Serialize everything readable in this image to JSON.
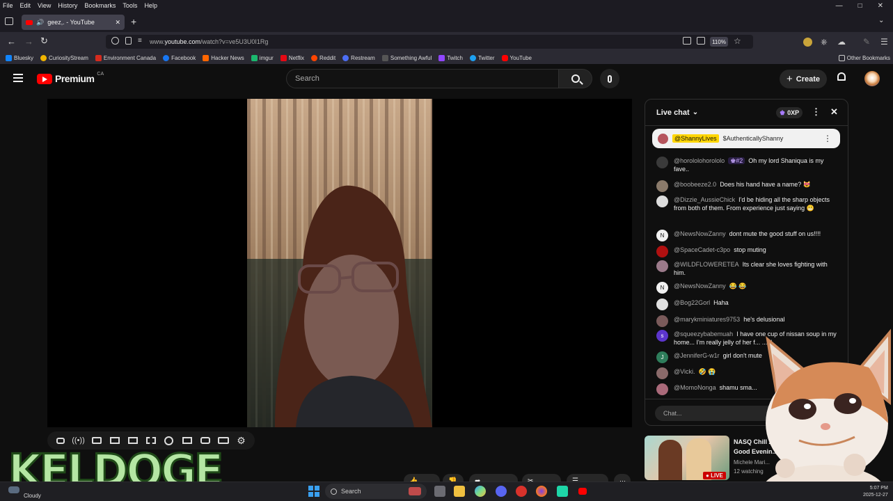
{
  "browser": {
    "menu": [
      "File",
      "Edit",
      "View",
      "History",
      "Bookmarks",
      "Tools",
      "Help"
    ],
    "tab_title": "geez,. - YouTube",
    "url_prefix": "www.",
    "url_host": "youtube.com",
    "url_path": "/watch?v=ve5U3U0I1Rg",
    "zoom": "110%",
    "other_bookmarks": "Other Bookmarks",
    "bookmarks": [
      {
        "label": "Bluesky",
        "color": "#1185fe"
      },
      {
        "label": "CuriosityStream",
        "color": "#f0b400"
      },
      {
        "label": "Environment Canada",
        "color": "#d52b1e"
      },
      {
        "label": "Facebook",
        "color": "#1877f2"
      },
      {
        "label": "Hacker News",
        "color": "#ff6600"
      },
      {
        "label": "imgur",
        "color": "#1bb76e"
      },
      {
        "label": "Netflix",
        "color": "#e50914"
      },
      {
        "label": "Reddit",
        "color": "#ff4500"
      },
      {
        "label": "Restream",
        "color": "#4c6ef5"
      },
      {
        "label": "Something Awful",
        "color": "#222222"
      },
      {
        "label": "Twitch",
        "color": "#9146ff"
      },
      {
        "label": "Twitter",
        "color": "#1da1f2"
      },
      {
        "label": "YouTube",
        "color": "#ff0000"
      }
    ]
  },
  "youtube": {
    "logo_text": "Premium",
    "region": "CA",
    "search_placeholder": "Search",
    "create_label": "Create"
  },
  "chat": {
    "title": "Live chat",
    "xp": "0XP",
    "pinned_user": "@ShannyLives",
    "pinned_text": "$AuthenticallyShanny",
    "input_placeholder": "Chat...",
    "messages": [
      {
        "author": "@horololohorololo",
        "badge": "#2",
        "text": "Oh my lord Shaniqua is my fave..",
        "avatar_color": "#3a3a3a"
      },
      {
        "author": "@boobeeze2.0",
        "text": "Does his hand have a name? 😻",
        "avatar_color": "#8a7a6a"
      },
      {
        "author": "@Dizzie_AussieChick",
        "text": "I'd be hiding all the sharp objects from both of them. From experience just saying 😬",
        "avatar_color": "#ddd"
      },
      {
        "author": "@NewsNowZanny",
        "text": "dont mute the good stuff on us!!!!",
        "avatar_color": "#f1f1f1"
      },
      {
        "author": "@SpaceCadet-c3po",
        "text": "stop muting",
        "avatar_color": "#b01010"
      },
      {
        "author": "@WILDFLOWERETEA",
        "text": "Its clear she loves fighting with him.",
        "avatar_color": "#9b7a8a"
      },
      {
        "author": "@NewsNowZanny",
        "text": "😂 😂",
        "avatar_color": "#f1f1f1"
      },
      {
        "author": "@Bog22Gorl",
        "text": "Haha",
        "avatar_color": "#e0e0e0"
      },
      {
        "author": "@marykminiatures9753",
        "text": "he's delusional",
        "avatar_color": "#7a5a5a"
      },
      {
        "author": "@squeezybabemuah",
        "text": "I have one cup of nissan soup in my home... I'm really jelly of her f... ...ol",
        "avatar_color": "#5c35cc"
      },
      {
        "author": "@JenniferG-w1r",
        "text": "girl don't mute",
        "avatar_color": "#2e7d5b"
      },
      {
        "author": "@Vicki.",
        "text": "🤣 😭",
        "avatar_color": "#8a6a6a"
      },
      {
        "author": "@MomoNonga",
        "text": "shamu sma...",
        "avatar_color": "#aa6a7a"
      }
    ]
  },
  "recommendation": {
    "title": "NASQ Chill zo... Good Evenin...",
    "channel": "Michele Mari...",
    "watching": "12 watching",
    "live_badge": "LIVE"
  },
  "overlay": {
    "logo": "KELDOGE"
  },
  "taskbar": {
    "weather": "Cloudy",
    "search_label": "Search",
    "time": "5:07 PM",
    "date": "2025-12-27"
  },
  "colors": {
    "yt_red": "#ff0000",
    "pinned_highlight": "#ffd600",
    "chat_badge_purple": "#7b3fe4",
    "keldoge_fill": "#b4e6a3"
  }
}
